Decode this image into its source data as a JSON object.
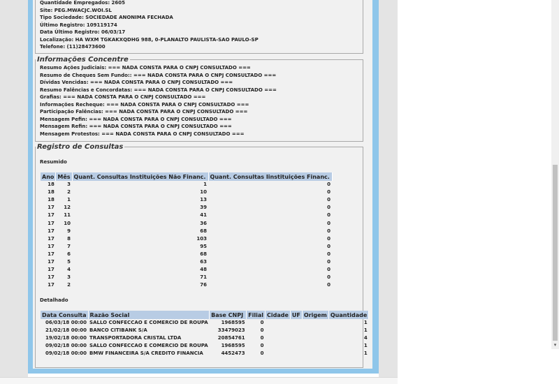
{
  "company": {
    "lines": [
      "Quantidade Empregados: 2605",
      "Site: PEG.MWACJC.WOI.SL",
      "Tipo Sociedade: SOCIEDADE ANONIMA FECHADA",
      "Último Registro: 109119174",
      "Data Último Registro: 06/03/17",
      "Localização: HA WXM TGKAKXQDHG 988, 0-PLANALTO PAULISTA-SAO PAULO-SP",
      "Telefone: (11)28473600"
    ]
  },
  "concentre": {
    "legend": "Informações Concentre",
    "lines": [
      "Resumo Ações Judiciais: === NADA CONSTA PARA O CNPJ CONSULTADO ===",
      "Resumo de Cheques Sem Fundo:: === NADA CONSTA PARA O CNPJ CONSULTADO ===",
      "Dívidas Vencidas: === NADA CONSTA PARA O CNPJ CONSULTADO ===",
      "Resumo Falências e Concordatas: === NADA CONSTA PARA O CNPJ CONSULTADO ===",
      "Grafias: === NADA CONSTA PARA O CNPJ CONSULTADO ===",
      "Informações Recheque: === NADA CONSTA PARA O CNPJ CONSULTADO ===",
      "Participação Falências: === NADA CONSTA PARA O CNPJ CONSULTADO ===",
      "Mensagem Pefin: === NADA CONSTA PARA O CNPJ CONSULTADO ===",
      "Mensagem Refin: === NADA CONSTA PARA O CNPJ CONSULTADO ===",
      "Mensagem Protestos: === NADA CONSTA PARA O CNPJ CONSULTADO ==="
    ]
  },
  "consultas": {
    "legend": "Registro de Consultas",
    "resumido_label": "Resumido",
    "detalhado_label": "Detalhado",
    "resumido_headers": [
      "Ano",
      "Mês",
      "Quant. Consultas Instituições Não Financ.",
      "Quant. Consultas Iinstituições Financ."
    ],
    "resumido_rows": [
      [
        "18",
        "3",
        "1",
        "0"
      ],
      [
        "18",
        "2",
        "10",
        "0"
      ],
      [
        "18",
        "1",
        "13",
        "0"
      ],
      [
        "17",
        "12",
        "39",
        "0"
      ],
      [
        "17",
        "11",
        "41",
        "0"
      ],
      [
        "17",
        "10",
        "36",
        "0"
      ],
      [
        "17",
        "9",
        "68",
        "0"
      ],
      [
        "17",
        "8",
        "103",
        "0"
      ],
      [
        "17",
        "7",
        "95",
        "0"
      ],
      [
        "17",
        "6",
        "68",
        "0"
      ],
      [
        "17",
        "5",
        "63",
        "0"
      ],
      [
        "17",
        "4",
        "48",
        "0"
      ],
      [
        "17",
        "3",
        "71",
        "0"
      ],
      [
        "17",
        "2",
        "76",
        "0"
      ]
    ],
    "detalhado_headers": [
      "Data Consulta",
      "Razão Social",
      "Base CNPJ",
      "Filial",
      "Cidade",
      "UF",
      "Origem",
      "Quantidade"
    ],
    "detalhado_rows": [
      [
        "06/03/18 00:00",
        "SALLO CONFECCAO E COMERCIO DE ROUPA",
        "1968595",
        "0",
        "",
        "",
        "",
        "1"
      ],
      [
        "21/02/18 00:00",
        "BANCO CITIBANK S/A",
        "33479023",
        "0",
        "",
        "",
        "",
        "1"
      ],
      [
        "19/02/18 00:00",
        "TRANSPORTADORA CRISTAL LTDA",
        "20854761",
        "0",
        "",
        "",
        "",
        "4"
      ],
      [
        "09/02/18 00:00",
        "SALLO CONFECCAO E COMERCIO DE ROUPA",
        "1968595",
        "0",
        "",
        "",
        "",
        "1"
      ],
      [
        "09/02/18 00:00",
        "BMW FINANCEIRA S/A CREDITO FINANCIA",
        "4452473",
        "0",
        "",
        "",
        "",
        "1"
      ]
    ]
  }
}
